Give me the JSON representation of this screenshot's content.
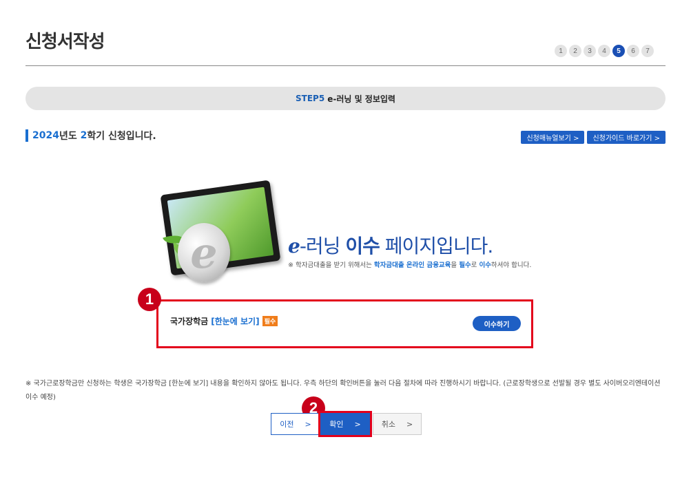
{
  "page": {
    "title": "신청서작성"
  },
  "steps": [
    "1",
    "2",
    "3",
    "4",
    "5",
    "6",
    "7"
  ],
  "active_step": "5",
  "banner": {
    "step_label": "STEP5",
    "step_title": "e-러닝 및 정보입력"
  },
  "semester": {
    "year": "2024",
    "year_suffix": "년도 ",
    "term": "2",
    "term_suffix": "학기 신청입니다."
  },
  "top_buttons": {
    "manual": "신청매뉴얼보기 >",
    "guide": "신청가이드 바로가기 >"
  },
  "elearning": {
    "e_glyph": "e",
    "headline_mid": "-러닝 ",
    "headline_bold": "이수",
    "headline_end": " 페이지입니다.",
    "sub_1": "※ 학자금대출을 받기 위해서는 ",
    "sub_2": "학자금대출 온라인 금융교육",
    "sub_3": "을 ",
    "sub_4": "필수",
    "sub_5": "로 ",
    "sub_6": "이수",
    "sub_7": "하셔야 합니다."
  },
  "course": {
    "name": "국가장학금",
    "link": "[한눈에 보기]",
    "required": "필수",
    "action": "이수하기"
  },
  "annotations": {
    "badge1": "1",
    "badge2": "2"
  },
  "footnote": "※ 국가근로장학금만 신청하는 학생은 국가장학금 [한눈에 보기] 내용을 확인하지 않아도 됩니다. 우측 하단의 확인버튼을 눌러 다음 절차에 따라 진행하시기 바랍니다. (근로장학생으로 선발될 경우 별도 사이버오리엔테이션 이수 예정)",
  "buttons": {
    "prev": "이전",
    "confirm": "확인",
    "cancel": "취소",
    "chevron": ">"
  },
  "colors": {
    "accent": "#1e5fc4",
    "annotation_red": "#e3001b",
    "required_orange": "#f07d1a"
  }
}
